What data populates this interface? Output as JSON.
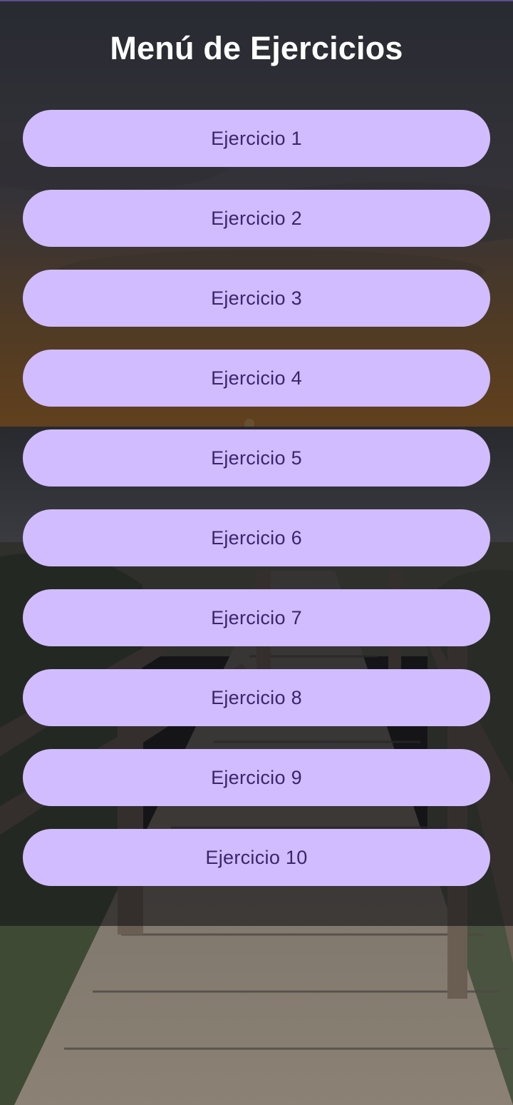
{
  "screen": {
    "title": "Menú de Ejercicios"
  },
  "menu": {
    "items": [
      {
        "label": "Ejercicio 1"
      },
      {
        "label": "Ejercicio 2"
      },
      {
        "label": "Ejercicio 3"
      },
      {
        "label": "Ejercicio 4"
      },
      {
        "label": "Ejercicio 5"
      },
      {
        "label": "Ejercicio 6"
      },
      {
        "label": "Ejercicio 7"
      },
      {
        "label": "Ejercicio 8"
      },
      {
        "label": "Ejercicio 9"
      },
      {
        "label": "Ejercicio 10"
      }
    ]
  },
  "colors": {
    "button_background": "#d1bcff",
    "button_text": "#3b2470",
    "title_text": "#ffffff"
  },
  "background": {
    "image": "sunset-beach-boardwalk"
  }
}
